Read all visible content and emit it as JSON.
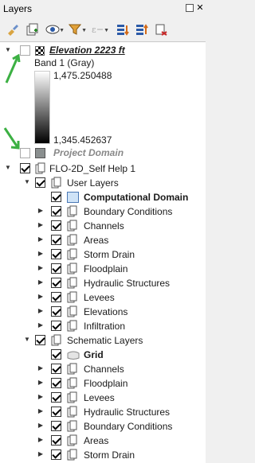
{
  "panel": {
    "title": "Layers"
  },
  "toolbar": {
    "tools": [
      {
        "name": "style-manager-icon"
      },
      {
        "name": "add-group-icon"
      },
      {
        "name": "manage-visibility-icon"
      },
      {
        "name": "filter-legend-icon"
      },
      {
        "name": "filter-expression-icon"
      },
      {
        "name": "expand-all-icon"
      },
      {
        "name": "collapse-all-icon"
      },
      {
        "name": "remove-layer-icon"
      }
    ]
  },
  "layers": {
    "elevation": {
      "label": "Elevation 2223 ft",
      "band": "Band 1 (Gray)",
      "max": "1,475.250488",
      "min": "1,345.452637"
    },
    "project_domain": {
      "label": "Project Domain"
    },
    "flo2d_group": {
      "label": "FLO-2D_Self Help 1"
    },
    "user_layers": {
      "label": "User Layers",
      "items": [
        {
          "label": "Computational Domain",
          "bold": true
        },
        {
          "label": "Boundary Conditions"
        },
        {
          "label": "Channels"
        },
        {
          "label": "Areas"
        },
        {
          "label": "Storm Drain"
        },
        {
          "label": "Floodplain"
        },
        {
          "label": "Hydraulic Structures"
        },
        {
          "label": "Levees"
        },
        {
          "label": "Elevations"
        },
        {
          "label": "Infiltration"
        }
      ]
    },
    "schematic_layers": {
      "label": "Schematic Layers",
      "items": [
        {
          "label": "Grid",
          "bold": true
        },
        {
          "label": "Channels"
        },
        {
          "label": "Floodplain"
        },
        {
          "label": "Levees"
        },
        {
          "label": "Hydraulic Structures"
        },
        {
          "label": "Boundary Conditions"
        },
        {
          "label": "Areas"
        },
        {
          "label": "Storm Drain"
        }
      ]
    }
  },
  "colors": {
    "annotation_arrow": "#3cb043",
    "computational_domain_fill": "#cfe3f7",
    "project_domain_fill": "#8a8f8f"
  }
}
